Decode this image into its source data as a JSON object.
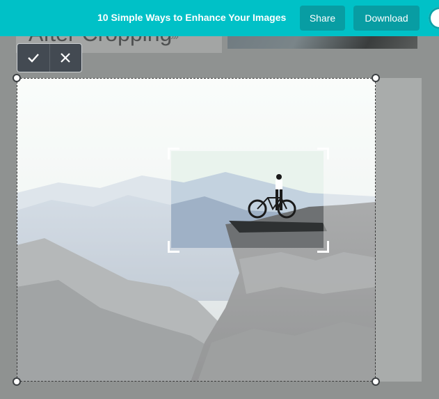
{
  "header": {
    "doc_title": "10 Simple Ways to Enhance Your Images",
    "share_label": "Share",
    "download_label": "Download"
  },
  "background": {
    "card_text": "After Cropping",
    "card_arrows": "›››"
  },
  "crop_toolbar": {
    "confirm_icon": "checkmark-icon",
    "cancel_icon": "close-icon"
  },
  "colors": {
    "header_bg": "#00c1c7",
    "button_bg": "#089da3",
    "toolbar_bg": "#434a52"
  }
}
